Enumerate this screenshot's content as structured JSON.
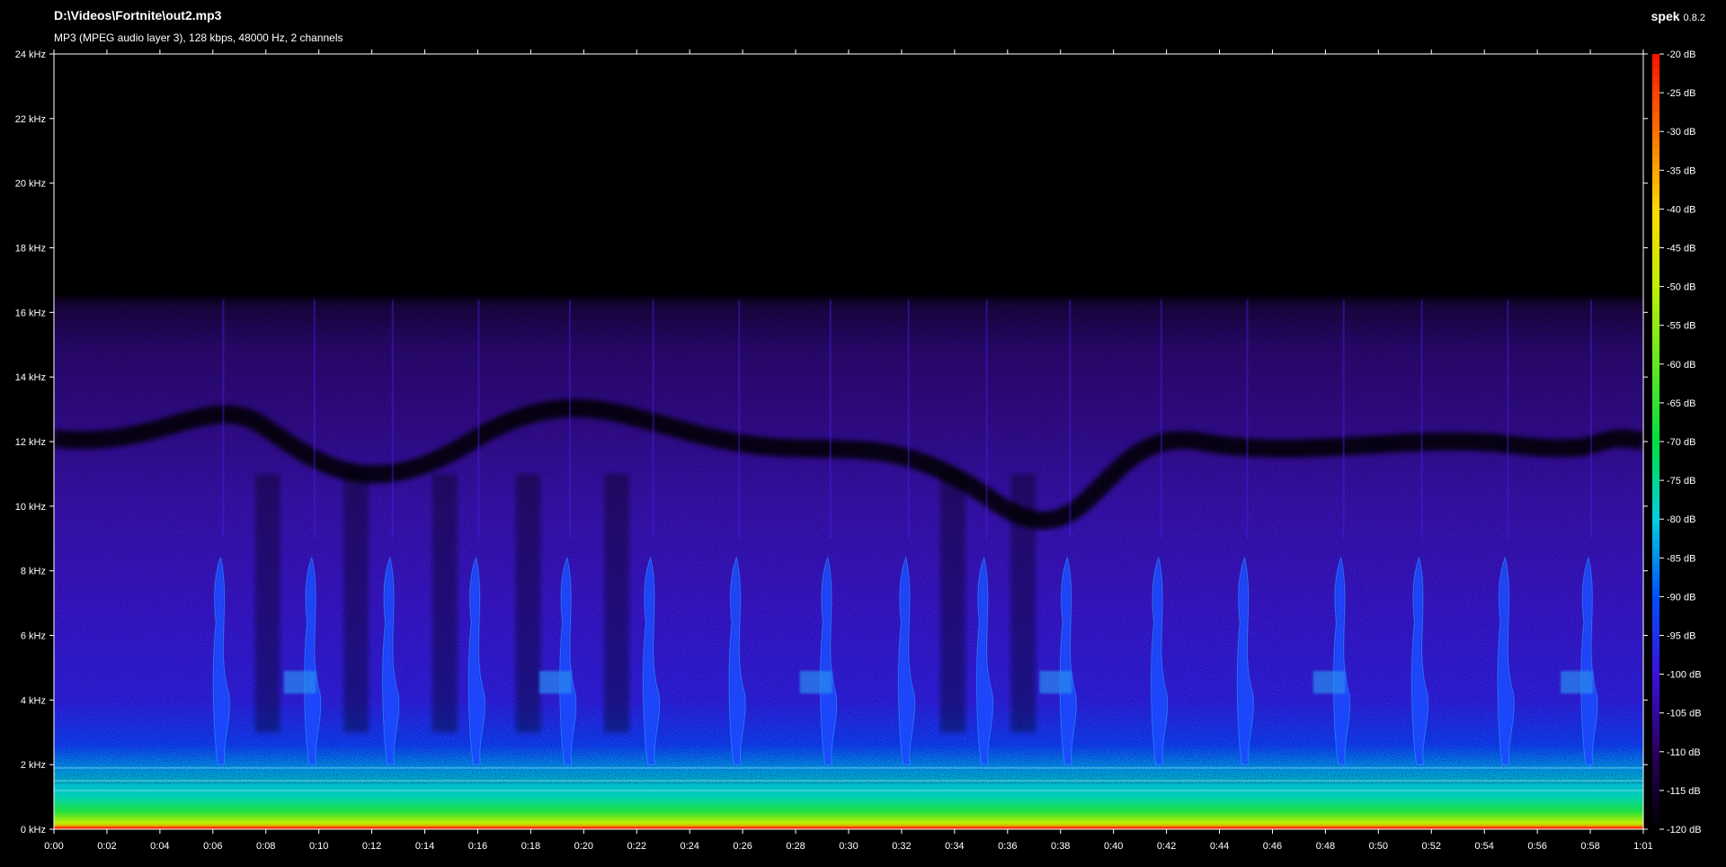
{
  "window": {
    "file_path": "D:\\Videos\\Fortnite\\out2.mp3",
    "file_info": "MP3 (MPEG audio layer 3), 128 kbps, 48000 Hz, 2 channels",
    "app_name": "spek",
    "app_version": "0.8.2"
  },
  "chart_data": {
    "type": "heatmap",
    "title": "D:\\Videos\\Fortnite\\out2.mp3",
    "subtitle": "MP3 (MPEG audio layer 3), 128 kbps, 48000 Hz, 2 channels",
    "xlabel": "",
    "ylabel": "",
    "x_unit": "time (m:ss)",
    "y_unit": "kHz",
    "duration_seconds": 61,
    "xlim": [
      0,
      61
    ],
    "ylim": [
      0,
      24
    ],
    "x_tick_labels": [
      "0:00",
      "0:02",
      "0:04",
      "0:06",
      "0:08",
      "0:10",
      "0:12",
      "0:14",
      "0:16",
      "0:18",
      "0:20",
      "0:22",
      "0:24",
      "0:26",
      "0:28",
      "0:30",
      "0:32",
      "0:34",
      "0:36",
      "0:38",
      "0:40",
      "0:42",
      "0:44",
      "0:46",
      "0:48",
      "0:50",
      "0:52",
      "0:54",
      "0:56",
      "0:58",
      "1:01"
    ],
    "y_ticks": [
      {
        "value": 0,
        "label": "0 kHz"
      },
      {
        "value": 2,
        "label": "2 kHz"
      },
      {
        "value": 4,
        "label": "4 kHz"
      },
      {
        "value": 6,
        "label": "6 kHz"
      },
      {
        "value": 8,
        "label": "8 kHz"
      },
      {
        "value": 10,
        "label": "10 kHz"
      },
      {
        "value": 12,
        "label": "12 kHz"
      },
      {
        "value": 14,
        "label": "14 kHz"
      },
      {
        "value": 16,
        "label": "16 kHz"
      },
      {
        "value": 18,
        "label": "18 kHz"
      },
      {
        "value": 20,
        "label": "20 kHz"
      },
      {
        "value": 22,
        "label": "22 kHz"
      },
      {
        "value": 24,
        "label": "24 kHz"
      }
    ],
    "colorbar": {
      "range_db": [
        -120,
        -20
      ],
      "labels": [
        {
          "value": -20,
          "label": "-20 dB"
        },
        {
          "value": -25,
          "label": "-25 dB"
        },
        {
          "value": -30,
          "label": "-30 dB"
        },
        {
          "value": -35,
          "label": "-35 dB"
        },
        {
          "value": -40,
          "label": "-40 dB"
        },
        {
          "value": -45,
          "label": "-45 dB"
        },
        {
          "value": -50,
          "label": "-50 dB"
        },
        {
          "value": -55,
          "label": "-55 dB"
        },
        {
          "value": -60,
          "label": "-60 dB"
        },
        {
          "value": -65,
          "label": "-65 dB"
        },
        {
          "value": -70,
          "label": "-70 dB"
        },
        {
          "value": -75,
          "label": "-75 dB"
        },
        {
          "value": -80,
          "label": "-80 dB"
        },
        {
          "value": -85,
          "label": "-85 dB"
        },
        {
          "value": -90,
          "label": "-90 dB"
        },
        {
          "value": -95,
          "label": "-95 dB"
        },
        {
          "value": -100,
          "label": "-100 dB"
        },
        {
          "value": -105,
          "label": "-105 dB"
        },
        {
          "value": -110,
          "label": "-110 dB"
        },
        {
          "value": -115,
          "label": "-115 dB"
        },
        {
          "value": -120,
          "label": "-120 dB"
        }
      ],
      "stops": [
        {
          "db": -120,
          "color": "#000000"
        },
        {
          "db": -110,
          "color": "#2a0060"
        },
        {
          "db": -100,
          "color": "#3a10e0"
        },
        {
          "db": -90,
          "color": "#0050ff"
        },
        {
          "db": -80,
          "color": "#00d0e0"
        },
        {
          "db": -70,
          "color": "#00e040"
        },
        {
          "db": -50,
          "color": "#c0f000"
        },
        {
          "db": -40,
          "color": "#ffd800"
        },
        {
          "db": -30,
          "color": "#ff7000"
        },
        {
          "db": -20,
          "color": "#ff1000"
        }
      ]
    },
    "approx_cutoff_khz": 16,
    "noise_floor_band_khz": [
      0,
      2
    ],
    "burst_times_seconds": [
      6.5,
      10.0,
      13.0,
      16.3,
      19.8,
      23.0,
      26.3,
      29.8,
      32.8,
      35.8,
      39.0,
      42.5,
      45.8,
      49.5,
      52.5,
      55.8,
      59.0
    ]
  }
}
